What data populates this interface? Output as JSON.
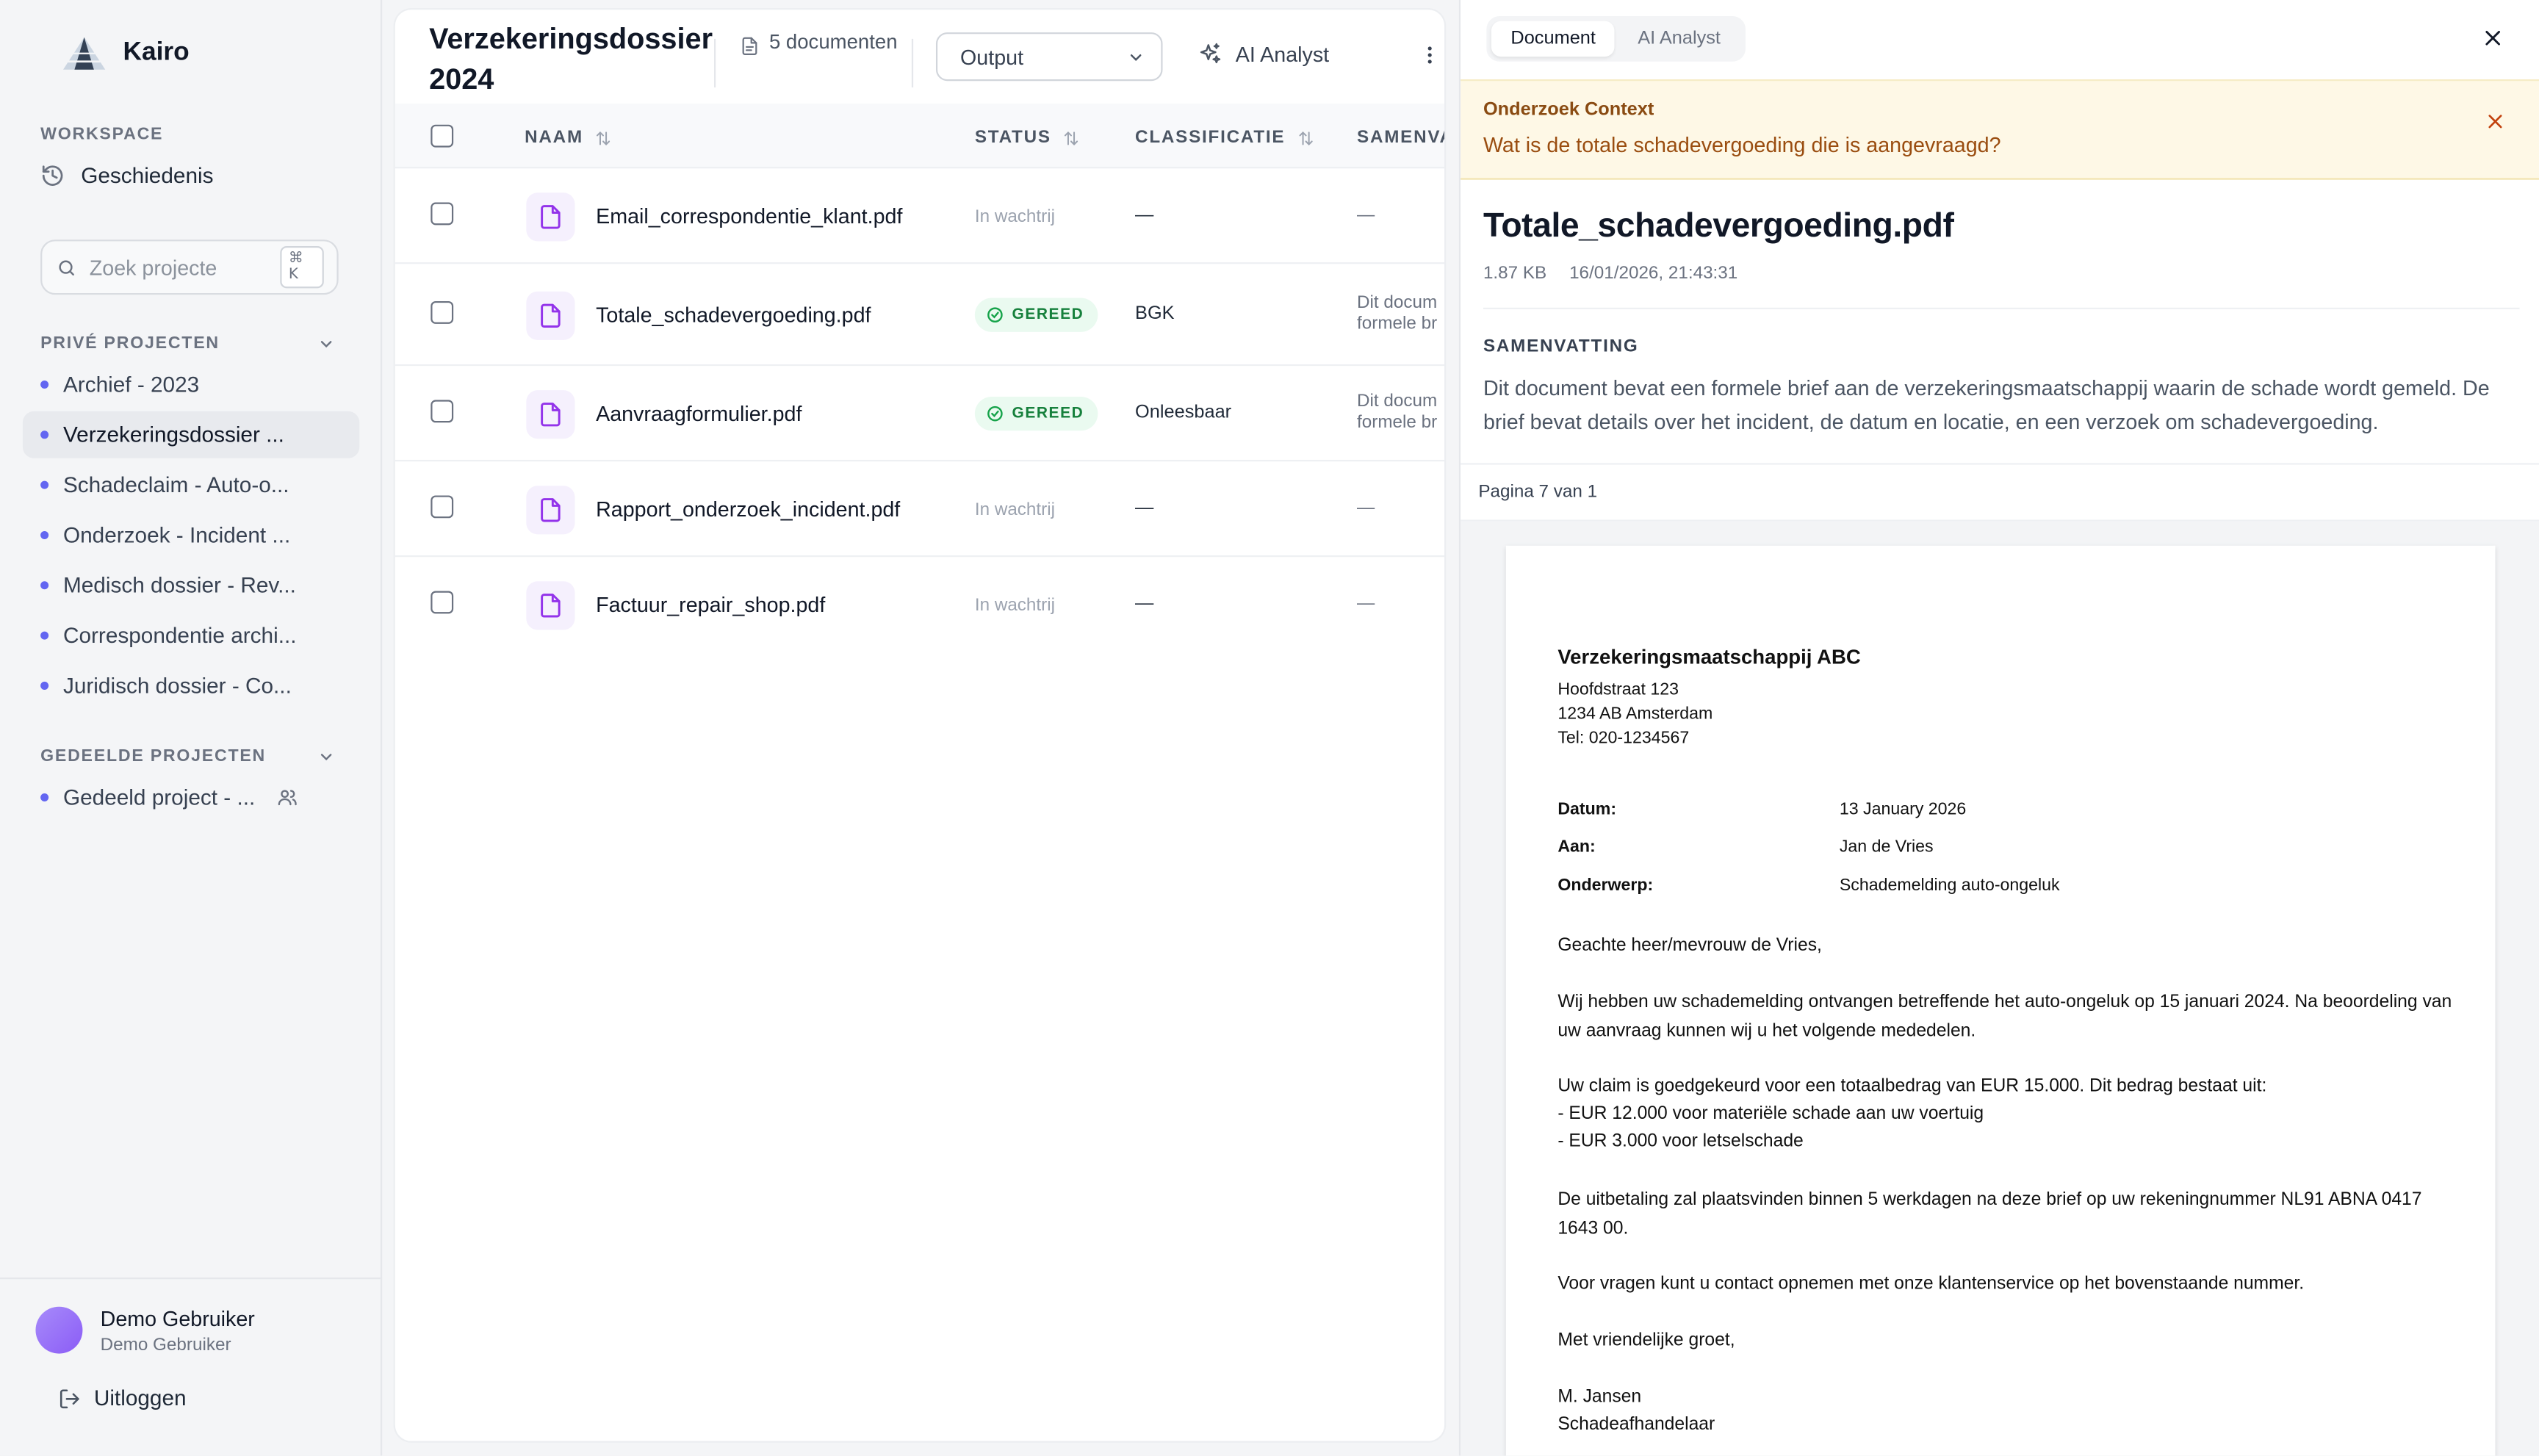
{
  "app": {
    "name": "Kairo"
  },
  "sidebar": {
    "workspace_label": "WORKSPACE",
    "history_label": "Geschiedenis",
    "search": {
      "placeholder": "Zoek projecte",
      "shortcut": "⌘ K"
    },
    "private_label": "PRIVÉ PROJECTEN",
    "private_projects": [
      {
        "label": "Archief - 2023"
      },
      {
        "label": "Verzekeringsdossier ..."
      },
      {
        "label": "Schadeclaim - Auto-o..."
      },
      {
        "label": "Onderzoek - Incident ..."
      },
      {
        "label": "Medisch dossier - Rev..."
      },
      {
        "label": "Correspondentie archi..."
      },
      {
        "label": "Juridisch dossier - Co..."
      }
    ],
    "active_project_index": 1,
    "shared_label": "GEDEELDE PROJECTEN",
    "shared_projects": [
      {
        "label": "Gedeeld project - ..."
      }
    ],
    "user": {
      "name": "Demo Gebruiker",
      "subtitle": "Demo Gebruiker"
    },
    "logout_label": "Uitloggen"
  },
  "main": {
    "title": "Verzekeringsdossier 2024",
    "doc_count": "5 documenten",
    "output_select": "Output",
    "ai_button": "AI Analyst",
    "columns": {
      "name": "NAAM",
      "status": "STATUS",
      "classification": "CLASSIFICATIE",
      "summary": "SAMENVA"
    },
    "rows": [
      {
        "name": "Email_correspondentie_klant.pdf",
        "status": "In wachtrij",
        "classification": "—",
        "summary_1": "—",
        "summary_2": ""
      },
      {
        "name": "Totale_schadevergoeding.pdf",
        "status": "GEREED",
        "classification": "BGK",
        "summary_1": "Dit docum",
        "summary_2": "formele br"
      },
      {
        "name": "Aanvraagformulier.pdf",
        "status": "GEREED",
        "classification": "Onleesbaar",
        "summary_1": "Dit docum",
        "summary_2": "formele br"
      },
      {
        "name": "Rapport_onderzoek_incident.pdf",
        "status": "In wachtrij",
        "classification": "—",
        "summary_1": "—",
        "summary_2": ""
      },
      {
        "name": "Factuur_repair_shop.pdf",
        "status": "In wachtrij",
        "classification": "—",
        "summary_1": "—",
        "summary_2": ""
      }
    ]
  },
  "panel": {
    "tabs": {
      "document": "Document",
      "ai": "AI Analyst"
    },
    "context_label": "Onderzoek Context",
    "context_question": "Wat is de totale schadevergoeding die is aangevraagd?",
    "doc_title": "Totale_schadevergoeding.pdf",
    "file_size": "1.87 KB",
    "timestamp": "16/01/2026, 21:43:31",
    "summary_label": "SAMENVATTING",
    "summary_text": "Dit document bevat een formele brief aan de verzekeringsmaatschappij waarin de schade wordt gemeld. De brief bevat details over het incident, de datum en locatie, en een verzoek om schadevergoeding.",
    "page_label": "Pagina 7 van 1"
  },
  "letter": {
    "company": "Verzekeringsmaatschappij ABC",
    "address_1": "Hoofdstraat 123",
    "address_2": "1234 AB Amsterdam",
    "phone": "Tel: 020-1234567",
    "date_label": "Datum:",
    "date_value": "13 January 2026",
    "to_label": "Aan:",
    "to_value": "Jan de Vries",
    "subject_label": "Onderwerp:",
    "subject_value": "Schademelding auto-ongeluk",
    "salutation": "Geachte heer/mevrouw de Vries,",
    "p1": "Wij hebben uw schademelding ontvangen betreffende het auto-ongeluk op 15 januari 2024. Na beoordeling van uw aanvraag kunnen wij u het volgende mededelen.",
    "p2": "Uw claim is goedgekeurd voor een totaalbedrag van EUR 15.000. Dit bedrag bestaat uit:",
    "p2_item1": "- EUR 12.000 voor materiële schade aan uw voertuig",
    "p2_item2": "- EUR 3.000 voor letselschade",
    "p3": "De uitbetaling zal plaatsvinden binnen 5 werkdagen na deze brief op uw rekeningnummer NL91 ABNA 0417 1643 00.",
    "p4": "Voor vragen kunt u contact opnemen met onze klantenservice op het bovenstaande nummer.",
    "closing": "Met vriendelijke groet,",
    "signer": "M. Jansen",
    "signer_title": "Schadeafhandelaar"
  },
  "colors": {
    "accent": "#6366f1",
    "file_icon": "#9333ea",
    "success": "#16a34a",
    "context_bg": "#fef8e6"
  }
}
